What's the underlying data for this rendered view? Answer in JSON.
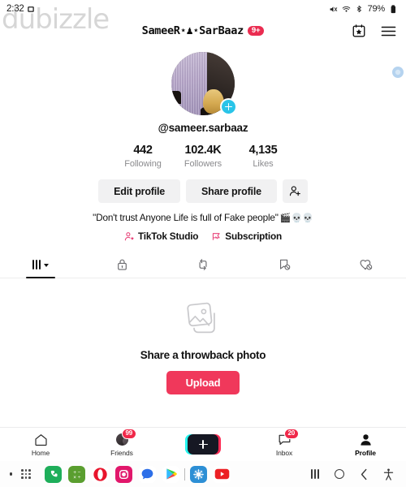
{
  "status_bar": {
    "time": "2:32",
    "alarm_icon": "alarm-icon",
    "mute_icon": "mute-icon",
    "wifi_icon": "wifi-icon",
    "bluetooth_icon": "bluetooth-icon",
    "battery_text": "79%",
    "battery_icon": "battery-icon"
  },
  "watermark": {
    "text": "dubizzle"
  },
  "header": {
    "title": "SameeR⋆♟⋆SarBaaz",
    "badge": "9+",
    "calendar_icon": "calendar-star-icon",
    "menu_icon": "hamburger-menu-icon"
  },
  "profile": {
    "avatar_alt": "profile-photo",
    "follow_plus_icon": "plus-icon",
    "handle": "@sameer.sarbaaz",
    "stats": [
      {
        "value": "442",
        "label": "Following"
      },
      {
        "value": "102.4K",
        "label": "Followers"
      },
      {
        "value": "4,135",
        "label": "Likes"
      }
    ],
    "edit_profile_label": "Edit profile",
    "share_profile_label": "Share profile",
    "add_friends_icon": "add-person-icon",
    "bio": "\"Don't trust Anyone Life is full of Fake people\"",
    "bio_emojis": "🎬💀💀",
    "links": [
      {
        "label": "TikTok Studio",
        "icon": "person-star-icon"
      },
      {
        "label": "Subscription",
        "icon": "subscription-flag-icon"
      }
    ]
  },
  "tabs": [
    {
      "name": "videos",
      "icon": "grid-chevron-icon",
      "active": true
    },
    {
      "name": "private",
      "icon": "lock-icon",
      "active": false
    },
    {
      "name": "reposts",
      "icon": "repost-icon",
      "active": false
    },
    {
      "name": "saved",
      "icon": "bookmark-hidden-icon",
      "active": false
    },
    {
      "name": "liked",
      "icon": "heart-hidden-icon",
      "active": false
    }
  ],
  "empty_state": {
    "icon": "photo-stack-icon",
    "message": "Share a throwback photo",
    "button_label": "Upload",
    "button_color": "#f0385b"
  },
  "bottom_nav": [
    {
      "name": "home",
      "label": "Home",
      "icon": "home-icon",
      "badge": null,
      "active": false
    },
    {
      "name": "friends",
      "label": "Friends",
      "icon": "friends-icon",
      "badge": "99",
      "active": false
    },
    {
      "name": "create",
      "label": "",
      "icon": "create-plus-icon",
      "badge": null,
      "active": false
    },
    {
      "name": "inbox",
      "label": "Inbox",
      "icon": "inbox-icon",
      "badge": "20",
      "active": false
    },
    {
      "name": "profile",
      "label": "Profile",
      "icon": "profile-person-icon",
      "badge": null,
      "active": true
    }
  ],
  "taskbar": {
    "dot_icon": "recent-dot-icon",
    "apps_grid_icon": "app-drawer-icon",
    "apps": [
      {
        "name": "phone",
        "icon": "phone-app-icon",
        "color": "#1eae5a"
      },
      {
        "name": "calculator",
        "icon": "calculator-app-icon",
        "color": "#5a9e2f"
      },
      {
        "name": "opera",
        "icon": "opera-app-icon",
        "color": "#e8142c"
      },
      {
        "name": "instagram",
        "icon": "instagram-app-icon",
        "color": "#e1176b"
      },
      {
        "name": "messages",
        "icon": "messages-app-icon",
        "color": "#2d6fe8"
      },
      {
        "name": "play-store",
        "icon": "play-store-app-icon",
        "color": "#4286f5"
      },
      {
        "name": "browser",
        "icon": "browser-app-icon",
        "color": "#2d8fd5"
      },
      {
        "name": "youtube",
        "icon": "youtube-app-icon",
        "color": "#ec2024"
      }
    ],
    "nav_buttons": [
      {
        "name": "recents",
        "icon": "recents-icon"
      },
      {
        "name": "home",
        "icon": "home-circle-icon"
      },
      {
        "name": "back",
        "icon": "back-chevron-icon"
      },
      {
        "name": "accessibility",
        "icon": "accessibility-icon"
      }
    ]
  },
  "floating_bubble": {
    "icon": "floating-bubble-icon"
  }
}
